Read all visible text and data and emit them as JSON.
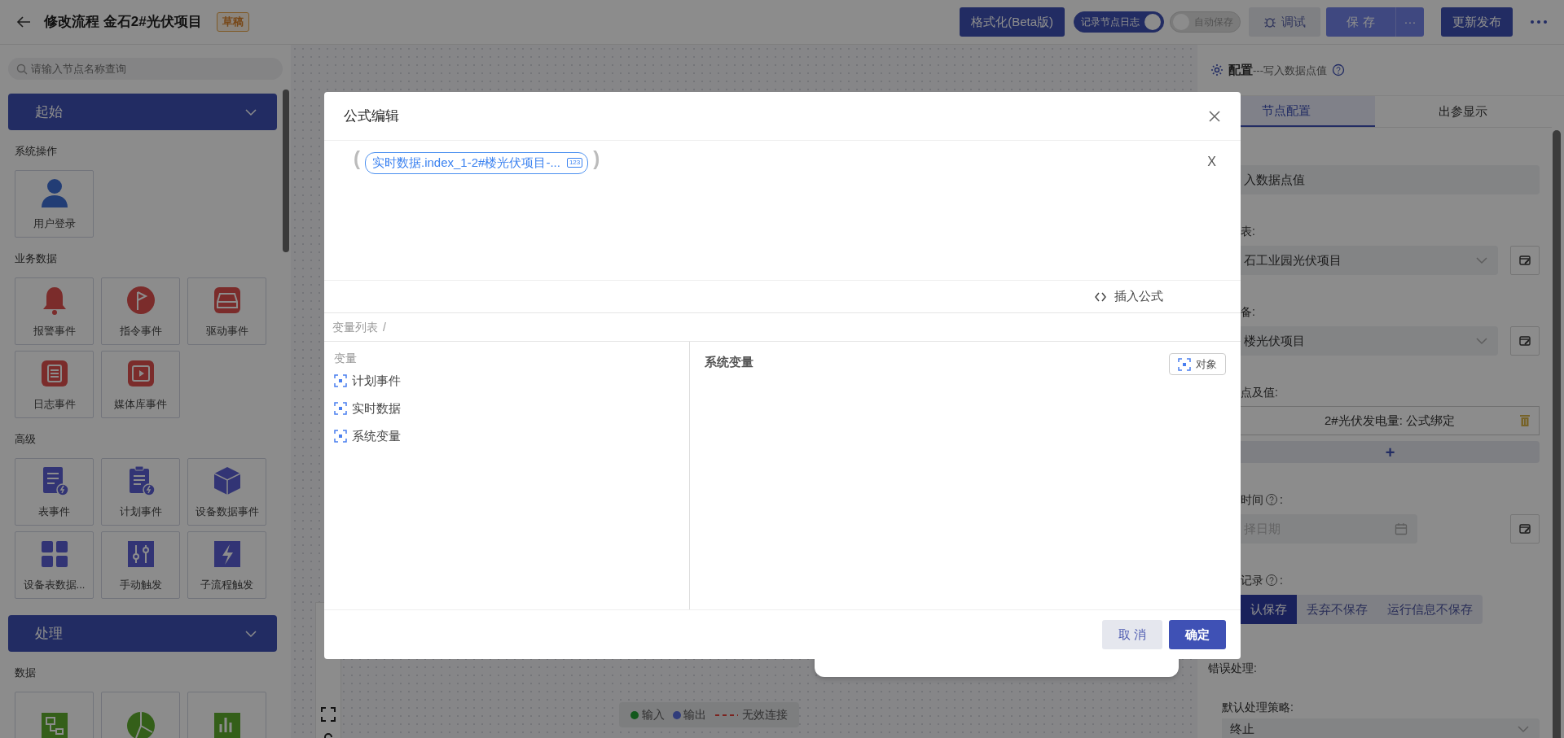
{
  "topbar": {
    "title": "修改流程 金石2#光伏项目",
    "status_badge": "草稿",
    "format_button": "格式化(Beta版)",
    "toggles": [
      {
        "label": "记录节点日志",
        "on": true
      },
      {
        "label": "自动保存",
        "on": false
      }
    ],
    "debug_button": "调试",
    "save_button": "保 存",
    "save_more": "···",
    "publish_button": "更新发布"
  },
  "sidebar": {
    "search": {
      "placeholder": "请输入节点名称查询"
    },
    "sections": [
      {
        "title": "起始",
        "expanded": true,
        "groups": [
          {
            "title": "系统操作",
            "nodes": [
              {
                "label": "用户登录"
              }
            ]
          },
          {
            "title": "业务数据",
            "nodes": [
              {
                "label": "报警事件"
              },
              {
                "label": "指令事件"
              },
              {
                "label": "驱动事件"
              },
              {
                "label": "日志事件"
              },
              {
                "label": "媒体库事件"
              }
            ]
          },
          {
            "title": "高级",
            "nodes": [
              {
                "label": "表事件"
              },
              {
                "label": "计划事件"
              },
              {
                "label": "设备数据事件"
              },
              {
                "label": "设备表数据..."
              },
              {
                "label": "手动触发"
              },
              {
                "label": "子流程触发"
              }
            ]
          }
        ]
      },
      {
        "title": "处理",
        "expanded": true,
        "groups": [
          {
            "title": "数据",
            "nodes": [
              {
                "kind": "table"
              },
              {
                "kind": "pie"
              },
              {
                "kind": "bars"
              }
            ]
          }
        ]
      }
    ]
  },
  "canvas": {
    "legend": [
      {
        "kind": "input",
        "label": "输入"
      },
      {
        "kind": "output",
        "label": "输出"
      },
      {
        "kind": "invalid",
        "label": "无效连接"
      }
    ]
  },
  "config_panel": {
    "title": "配置",
    "subtitle": "---写入数据点值",
    "tabs": [
      {
        "label": "节点配置",
        "selected": true
      },
      {
        "label": "出参显示",
        "selected": false
      }
    ],
    "fields": [
      {
        "kind": "text",
        "value": "入数据点值"
      },
      {
        "kind": "select",
        "label": "表:",
        "value": "石工业园光伏项目",
        "edit": true
      },
      {
        "kind": "select",
        "label": "备:",
        "value": "楼光伏项目",
        "edit": true
      },
      {
        "kind": "points",
        "label": "点及值:",
        "items": [
          "2#光伏发电量: 公式绑定"
        ],
        "add": "+"
      },
      {
        "kind": "date",
        "label": "时间",
        "help": true,
        "after": ":",
        "placeholder": "择日期",
        "edit": true
      },
      {
        "kind": "segmented",
        "label": "记录",
        "help": true,
        "after": ":",
        "options": [
          {
            "label": "认保存",
            "selected": true
          },
          {
            "label": "丢弃不保存",
            "selected": false
          },
          {
            "label": "运行信息不保存",
            "selected": false
          }
        ]
      },
      {
        "kind": "section",
        "label": "错误处理:"
      },
      {
        "kind": "subselect",
        "label": "默认处理策略:",
        "value": "终止"
      }
    ]
  },
  "formula_dialog": {
    "title": "公式编辑",
    "open_paren": "(",
    "close_paren": ")",
    "chip": "实时数据.index_1-2#楼光伏项目-...",
    "chip_type": "123",
    "clear": "X",
    "insert_formula": "插入公式",
    "breadcrumb": [
      "变量列表",
      "/"
    ],
    "variables": {
      "heading": "变量",
      "items": [
        "计划事件",
        "实时数据",
        "系统变量"
      ]
    },
    "detail": {
      "title": "系统变量",
      "object_button": "对象"
    },
    "buttons": [
      {
        "label": "取 消",
        "kind": "secondary"
      },
      {
        "label": "确定",
        "kind": "primary"
      }
    ]
  }
}
